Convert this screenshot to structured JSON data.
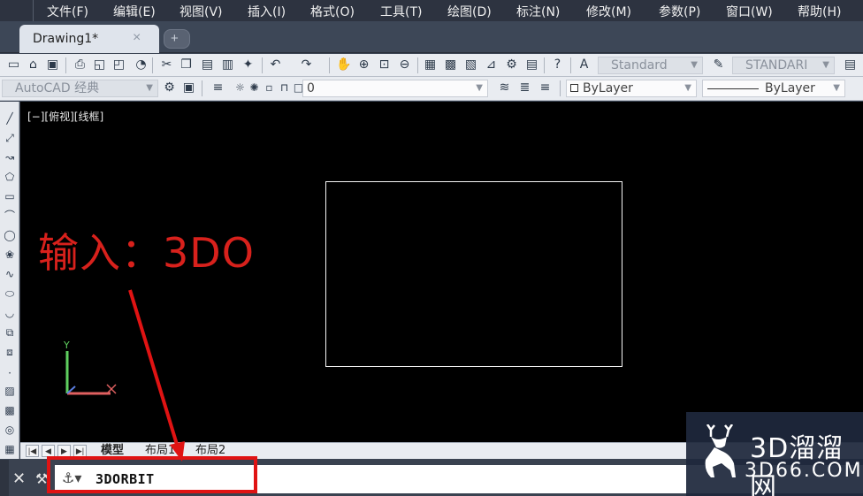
{
  "menu": {
    "items": [
      {
        "label": "文件(F)"
      },
      {
        "label": "编辑(E)"
      },
      {
        "label": "视图(V)"
      },
      {
        "label": "插入(I)"
      },
      {
        "label": "格式(O)"
      },
      {
        "label": "工具(T)"
      },
      {
        "label": "绘图(D)"
      },
      {
        "label": "标注(N)"
      },
      {
        "label": "修改(M)"
      },
      {
        "label": "参数(P)"
      },
      {
        "label": "窗口(W)"
      },
      {
        "label": "帮助(H)"
      }
    ]
  },
  "tabs": {
    "document_tab": "Drawing1*",
    "close_glyph": "×",
    "new_tab_glyph": "+"
  },
  "toolbar1": {
    "text_style": "Standard",
    "dim_style": "STANDARI"
  },
  "toolbar2": {
    "workspace": "AutoCAD 经典",
    "layer": "0",
    "color": "ByLayer",
    "linetype": "ByLayer"
  },
  "canvas": {
    "view_label": "[−][俯视][线框]",
    "annotation": "输入：3DO",
    "ucs_y": "Y"
  },
  "layout_tabs": [
    {
      "label": "模型"
    },
    {
      "label": "布局1"
    },
    {
      "label": "布局2"
    }
  ],
  "command": {
    "close_glyph": "✕",
    "text": "3DORBIT"
  },
  "watermark": {
    "name": "3D溜溜网",
    "domain": "3D66.COM"
  },
  "colors": {
    "annotation_red": "#d8211c",
    "highlight_red": "#e01313",
    "canvas_bg": "#000000"
  }
}
